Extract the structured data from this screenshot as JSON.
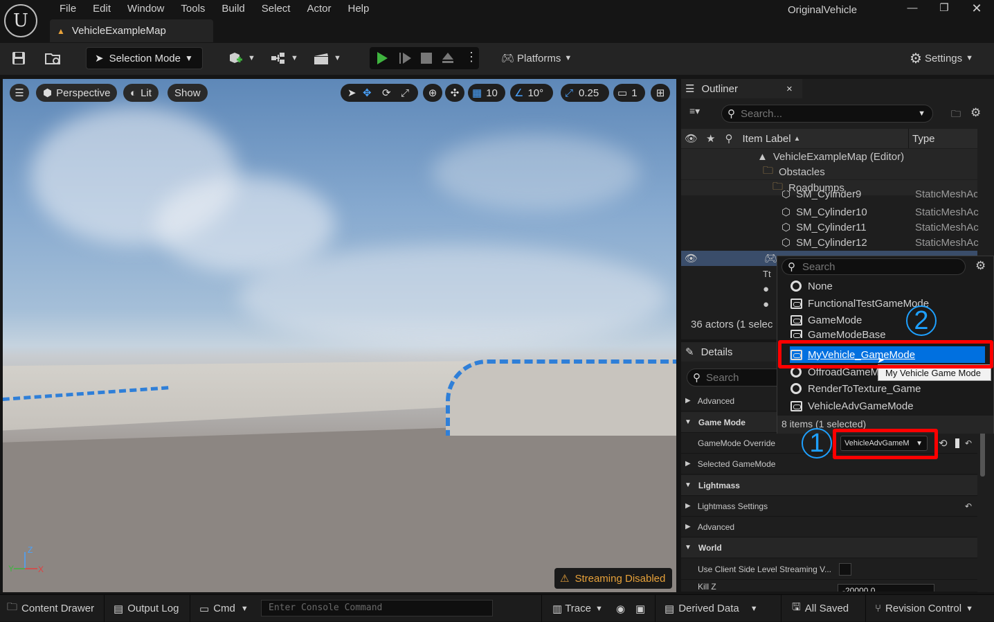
{
  "app": {
    "logo": "U",
    "window_title": "OriginalVehicle"
  },
  "menu": [
    "File",
    "Edit",
    "Window",
    "Tools",
    "Build",
    "Select",
    "Actor",
    "Help"
  ],
  "map_tab": {
    "label": "VehicleExampleMap"
  },
  "toolbar": {
    "selection_mode": "Selection Mode",
    "platforms": "Platforms",
    "settings": "Settings"
  },
  "viewport": {
    "menu_icon": "hamburger-icon",
    "perspective": "Perspective",
    "lit": "Lit",
    "show": "Show",
    "grid_size": "10",
    "rotation_snap": "10°",
    "scale_snap": "0.25",
    "camera_speed": "1",
    "streaming_status": "Streaming Disabled",
    "axis_z": "Z",
    "axis_x": "X",
    "axis_y": "Y"
  },
  "outliner": {
    "tab": "Outliner",
    "search_placeholder": "Search...",
    "col_label": "Item Label",
    "col_type": "Type",
    "rows": [
      {
        "label": "VehicleExampleMap (Editor)",
        "type": ""
      },
      {
        "label": "Obstacles",
        "type": ""
      },
      {
        "label": "Roadbumps",
        "type": ""
      },
      {
        "label": "SM_Cylinder9",
        "type": "StaticMeshAc"
      },
      {
        "label": "SM_Cylinder10",
        "type": "StaticMeshAc"
      },
      {
        "label": "SM_Cylinder11",
        "type": "StaticMeshAc"
      },
      {
        "label": "SM_Cylinder12",
        "type": "StaticMeshAc"
      }
    ],
    "actor_count": "36 actors (1 selec"
  },
  "details": {
    "tab": "Details",
    "search_placeholder": "Search",
    "rows": {
      "advanced1": "Advanced",
      "game_mode": "Game Mode",
      "gamemode_override": "GameMode Override",
      "gamemode_value": "VehicleAdvGameM",
      "selected_gamemode": "Selected GameMode",
      "lightmass": "Lightmass",
      "lightmass_settings": "Lightmass Settings",
      "advanced2": "Advanced",
      "world": "World",
      "client_streaming": "Use Client Side Level Streaming V...",
      "kill_z": "Kill Z",
      "kill_z_value": "-20000.0"
    }
  },
  "dropdown": {
    "search_placeholder": "Search",
    "items": [
      {
        "label": "None",
        "icon": "radio"
      },
      {
        "label": "FunctionalTestGameMode",
        "icon": "gamemode"
      },
      {
        "label": "GameMode",
        "icon": "gamemode"
      },
      {
        "label": "GameModeBase",
        "icon": "gamemode"
      },
      {
        "label": "MyVehicle_GameMode",
        "icon": "gamemode"
      },
      {
        "label": "OffroadGameM",
        "icon": "radio"
      },
      {
        "label": "RenderToTexture_Game",
        "icon": "radio"
      },
      {
        "label": "VehicleAdvGameMode",
        "icon": "gamemode"
      }
    ],
    "tooltip": "My Vehicle Game Mode",
    "footer": "8 items (1 selected)"
  },
  "annotations": {
    "step1": "1",
    "step2": "2",
    "highlight_color": "#ff0000",
    "number_color": "#1ea0ff"
  },
  "statusbar": {
    "content_drawer": "Content Drawer",
    "output_log": "Output Log",
    "cmd": "Cmd",
    "console_placeholder": "Enter Console Command",
    "trace": "Trace",
    "derived_data": "Derived Data",
    "all_saved": "All Saved",
    "revision_control": "Revision Control"
  }
}
